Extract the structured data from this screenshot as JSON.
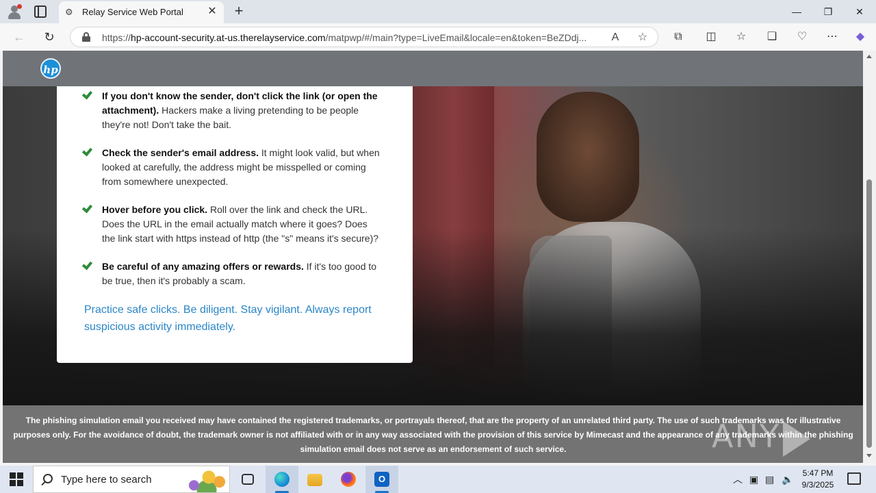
{
  "browser": {
    "tab_title": "Relay Service Web Portal",
    "url_prefix": "https://",
    "url_host": "hp-account-security.at-us.therelayservice.com",
    "url_path": "/matpwp/#/main?type=LiveEmail&locale=en&token=BeZDdj...",
    "new_tab_glyph": "+",
    "close_glyph": "✕"
  },
  "page": {
    "logo_text": "hp",
    "tips": [
      {
        "bold": "If you don't know the sender, don't click the link (or open the attachment).",
        "rest": " Hackers make a living pretending to be people they're not! Don't take the bait."
      },
      {
        "bold": "Check the sender's email address.",
        "rest": " It might look valid, but when looked at carefully, the address might be misspelled or coming from somewhere unexpected."
      },
      {
        "bold": "Hover before you click.",
        "rest": " Roll over the link and check the URL. Does the URL in the email actually match where it goes? Does the link start with https instead of http (the \"s\" means it's secure)?"
      },
      {
        "bold": "Be careful of any amazing offers or rewards.",
        "rest": " If it's too good to be true, then it's probably a scam."
      }
    ],
    "cta": "Practice safe clicks. Be diligent. Stay vigilant. Always report suspicious activity immediately.",
    "footer": "The phishing simulation email you received may have contained the registered trademarks, or portrayals thereof, that are the property of an unrelated third party. The use of such trademarks was for illustrative purposes only. For the avoidance of doubt, the trademark owner is not affiliated with or in any way associated with the provision of this service by Mimecast and the appearance of any trademarks within the phishing simulation email does not serve as an endorsement of such service.",
    "watermark_left": "ANY",
    "watermark_right": "RUN"
  },
  "taskbar": {
    "search_placeholder": "Type here to search",
    "time": "5:47 PM",
    "date": "9/3/2025"
  },
  "colors": {
    "accent_link": "#2a86c7",
    "check_green": "#2e8b3a",
    "hp_blue": "#1c8fd6"
  }
}
